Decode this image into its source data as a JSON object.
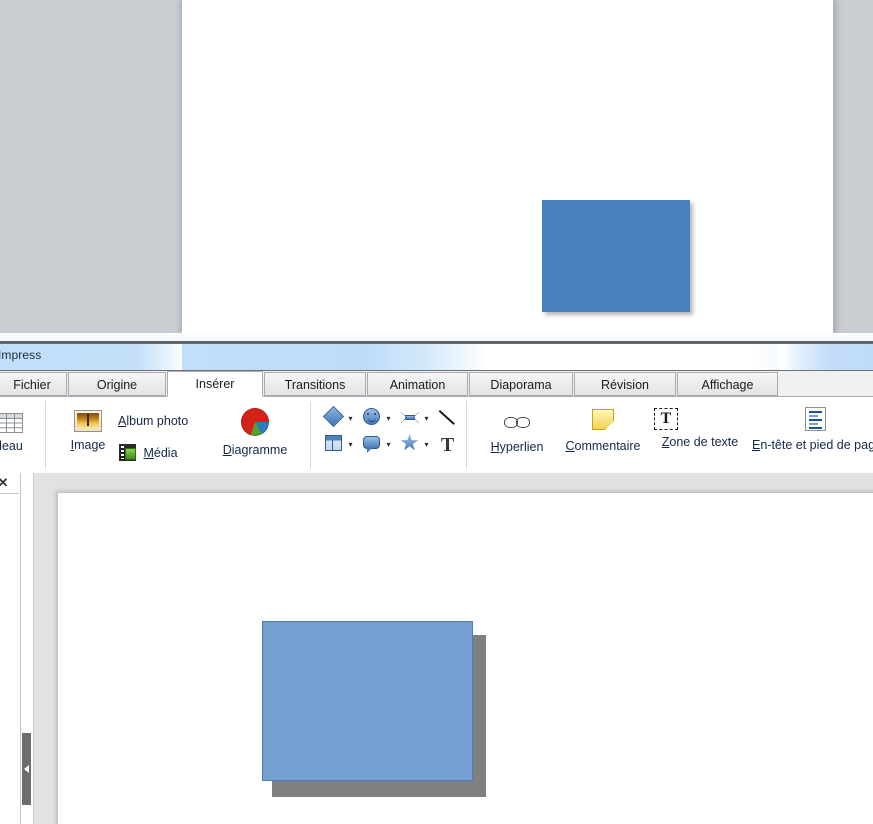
{
  "back_window": {
    "name": "impress-background-window",
    "shape": {
      "name": "blue-rectangle",
      "fill": "#4a7fbd"
    },
    "canvas_bg": "#ffffff",
    "desktop_bg": "#c9ced3"
  },
  "titlebar": {
    "title": "Impress",
    "accent": "#c2def8"
  },
  "tabs": [
    {
      "label": "Fichier",
      "active": false
    },
    {
      "label": "Origine",
      "active": false
    },
    {
      "label": "Insérer",
      "active": true
    },
    {
      "label": "Transitions",
      "active": false
    },
    {
      "label": "Animation",
      "active": false
    },
    {
      "label": "Diaporama",
      "active": false
    },
    {
      "label": "Révision",
      "active": false
    },
    {
      "label": "Affichage",
      "active": false
    }
  ],
  "ribbon": {
    "table_group": {
      "label_truncated": "leau",
      "full_label": "Tableau",
      "icon": "table-icon"
    },
    "illustrations": [
      {
        "name": "image",
        "label": "Image",
        "accel": "I",
        "icon": "picture-icon"
      },
      {
        "name": "album-photo",
        "label": "Album photo",
        "accel": "A",
        "icon": "photo-album-icon"
      },
      {
        "name": "media",
        "label": "Média",
        "accel": "M",
        "icon": "media-film-icon"
      },
      {
        "name": "diagramme",
        "label": "Diagramme",
        "accel": "D",
        "icon": "pie-chart-icon"
      }
    ],
    "shapes_gallery": {
      "row1": [
        {
          "name": "basic-shapes",
          "icon": "diamond-icon"
        },
        {
          "name": "symbol-shapes",
          "icon": "smiley-icon"
        },
        {
          "name": "block-arrows",
          "icon": "double-arrow-icon"
        },
        {
          "name": "line",
          "icon": "line-icon"
        }
      ],
      "row2": [
        {
          "name": "flowchart-shapes",
          "icon": "table-grid-icon"
        },
        {
          "name": "callout-shapes",
          "icon": "callout-icon"
        },
        {
          "name": "star-shapes",
          "icon": "star-icon"
        },
        {
          "name": "fontwork",
          "icon": "text-T-icon"
        }
      ]
    },
    "links_group": [
      {
        "name": "hyperlien",
        "label": "Hyperlien",
        "accel": "H",
        "icon": "chain-link-icon"
      },
      {
        "name": "commentaire",
        "label": "Commentaire",
        "accel": "C",
        "icon": "sticky-note-icon"
      },
      {
        "name": "zone-de-texte",
        "label": "Zone de texte",
        "accel": "Z",
        "icon": "text-box-icon"
      },
      {
        "name": "en-tete-pied-de-page",
        "label": "En-tête et pied de pag",
        "accel": "E",
        "icon": "header-footer-icon"
      }
    ]
  },
  "workspace": {
    "close_button": "✕",
    "collapse_handle": "◀",
    "slide": {
      "bg": "#ffffff",
      "shape": {
        "name": "blue-rectangle-selected",
        "fill": "#759fd1",
        "border": "#4f7bb0",
        "shadow": "#808080"
      }
    }
  }
}
